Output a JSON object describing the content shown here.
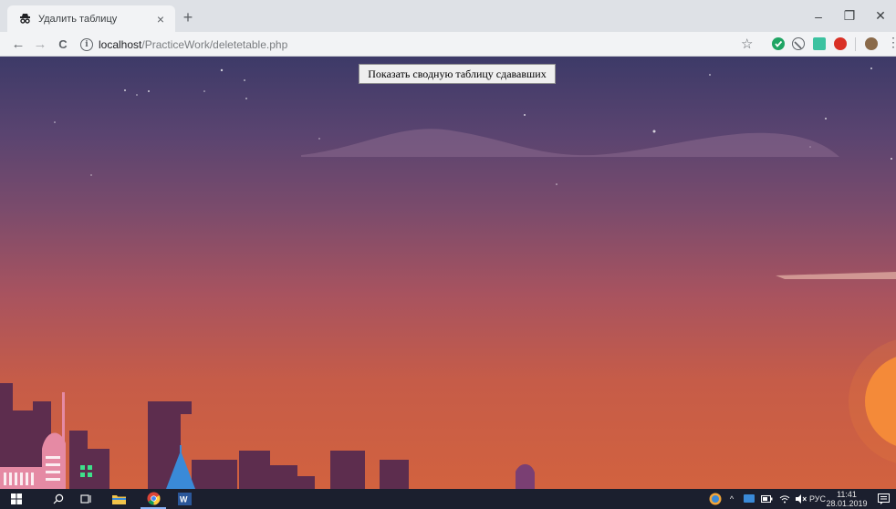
{
  "browser": {
    "tab": {
      "title": "Удалить таблицу",
      "close_icon": "×"
    },
    "new_tab_icon": "+",
    "window_controls": {
      "minimize": "–",
      "restore": "❐",
      "close": "✕"
    },
    "toolbar": {
      "back_icon": "←",
      "forward_icon": "→",
      "reload_icon": "C",
      "info_icon": "i",
      "url_host": "localhost",
      "url_path": "/PracticeWork/deletetable.php",
      "star_icon": "☆",
      "menu_icon": "⋮"
    },
    "extensions": [
      {
        "name": "check-extension",
        "color": "#1fa463"
      },
      {
        "name": "block-extension",
        "color": "#5f6368"
      },
      {
        "name": "green-extension",
        "color": "#3cc2a0"
      },
      {
        "name": "adblock-extension",
        "color": "#d93025"
      },
      {
        "name": "profile-avatar",
        "color": "#8a6a4a"
      }
    ]
  },
  "page": {
    "show_summary_button": "Показать сводную таблицу сдававших"
  },
  "taskbar": {
    "lang": "РУС",
    "time": "11:41",
    "date": "28.01.2019",
    "tray_chevron": "^"
  }
}
